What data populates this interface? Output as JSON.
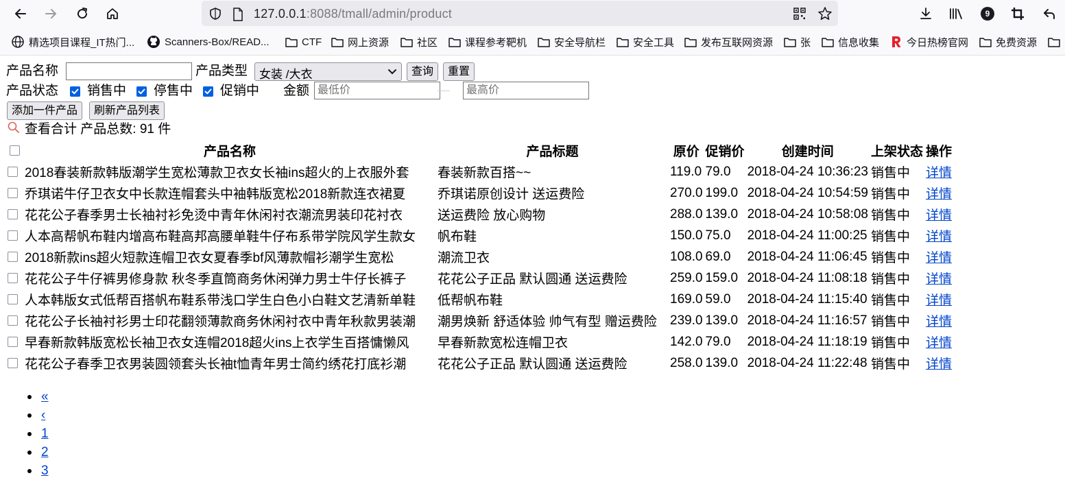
{
  "browser": {
    "url_host": "127.0.0.1",
    "url_rest": ":8088/tmall/admin/product",
    "badge_count": "9",
    "bookmarks": [
      {
        "label": "精选项目课程_IT热门...",
        "icon": "globe-icon"
      },
      {
        "label": "Scanners-Box/READ...",
        "icon": "github-icon"
      },
      {
        "label": "CTF",
        "icon": "folder-icon"
      },
      {
        "label": "网上资源",
        "icon": "folder-icon"
      },
      {
        "label": "社区",
        "icon": "folder-icon"
      },
      {
        "label": "课程参考靶机",
        "icon": "folder-icon"
      },
      {
        "label": "安全导航栏",
        "icon": "folder-icon"
      },
      {
        "label": "安全工具",
        "icon": "folder-icon"
      },
      {
        "label": "发布互联网资源",
        "icon": "folder-icon"
      },
      {
        "label": "张",
        "icon": "folder-icon"
      },
      {
        "label": "信息收集",
        "icon": "folder-icon"
      },
      {
        "label": "今日热榜官网",
        "icon": "rebang-icon"
      },
      {
        "label": "免费资源",
        "icon": "folder-icon"
      }
    ]
  },
  "filters": {
    "name_label": "产品名称",
    "name_value": "",
    "type_label": "产品类型",
    "type_selected": "女装 /大衣",
    "query_button": "查询",
    "reset_button": "重置",
    "status_label": "产品状态",
    "status_options": [
      {
        "label": "销售中",
        "checked": true
      },
      {
        "label": "停售中",
        "checked": true
      },
      {
        "label": "促销中",
        "checked": true
      }
    ],
    "amount_label": "金额",
    "min_placeholder": "最低价",
    "max_placeholder": "最高价",
    "add_button": "添加一件产品",
    "refresh_button": "刷新产品列表"
  },
  "summary": {
    "text": "查看合计 产品总数: 91 件"
  },
  "table": {
    "headers": [
      "产品名称",
      "产品标题",
      "原价",
      "促销价",
      "创建时间",
      "上架状态",
      "操作"
    ],
    "rows": [
      {
        "name": "2018春装新款韩版潮学生宽松薄款卫衣女长袖ins超火的上衣服外套",
        "title": "春装新款百搭~~",
        "price": "119.0",
        "sale": "79.0",
        "created": "2018-04-24 10:36:23",
        "status": "销售中",
        "action": "详情"
      },
      {
        "name": "乔琪诺牛仔卫衣女中长款连帽套头中袖韩版宽松2018新款连衣裙夏",
        "title": "乔琪诺原创设计 送运费险",
        "price": "270.0",
        "sale": "199.0",
        "created": "2018-04-24 10:54:59",
        "status": "销售中",
        "action": "详情"
      },
      {
        "name": "花花公子春季男士长袖衬衫免烫中青年休闲衬衣潮流男装印花衬衣",
        "title": "送运费险 放心购物",
        "price": "288.0",
        "sale": "139.0",
        "created": "2018-04-24 10:58:08",
        "status": "销售中",
        "action": "详情"
      },
      {
        "name": "人本高帮帆布鞋内增高布鞋高邦高腰单鞋牛仔布系带学院风学生款女",
        "title": "帆布鞋",
        "price": "150.0",
        "sale": "75.0",
        "created": "2018-04-24 11:00:25",
        "status": "销售中",
        "action": "详情"
      },
      {
        "name": "2018新款ins超火短款连帽卫衣女夏春季bf风薄款帽衫潮学生宽松",
        "title": "潮流卫衣",
        "price": "108.0",
        "sale": "69.0",
        "created": "2018-04-24 11:06:45",
        "status": "销售中",
        "action": "详情"
      },
      {
        "name": "花花公子牛仔裤男修身款 秋冬季直筒商务休闲弹力男士牛仔长裤子",
        "title": "花花公子正品 默认圆通 送运费险",
        "price": "259.0",
        "sale": "159.0",
        "created": "2018-04-24 11:08:18",
        "status": "销售中",
        "action": "详情"
      },
      {
        "name": "人本韩版女式低帮百搭帆布鞋系带浅口学生白色小白鞋文艺清新单鞋",
        "title": "低帮帆布鞋",
        "price": "169.0",
        "sale": "59.0",
        "created": "2018-04-24 11:15:40",
        "status": "销售中",
        "action": "详情"
      },
      {
        "name": "花花公子长袖衬衫男士印花翻领薄款商务休闲衬衣中青年秋款男装潮",
        "title": "潮男焕新 舒适体验 帅气有型 赠运费险",
        "price": "239.0",
        "sale": "139.0",
        "created": "2018-04-24 11:16:57",
        "status": "销售中",
        "action": "详情"
      },
      {
        "name": "早春新款韩版宽松长袖卫衣女连帽2018超火ins上衣学生百搭慵懒风",
        "title": "早春新款宽松连帽卫衣",
        "price": "142.0",
        "sale": "79.0",
        "created": "2018-04-24 11:18:19",
        "status": "销售中",
        "action": "详情"
      },
      {
        "name": "花花公子春季卫衣男装圆领套头长袖t恤青年男士简约绣花打底衫潮",
        "title": "花花公子正品 默认圆通 送运费险",
        "price": "258.0",
        "sale": "139.0",
        "created": "2018-04-24 11:22:48",
        "status": "销售中",
        "action": "详情"
      }
    ]
  },
  "pagination": [
    "«",
    "‹",
    "1",
    "2",
    "3"
  ]
}
